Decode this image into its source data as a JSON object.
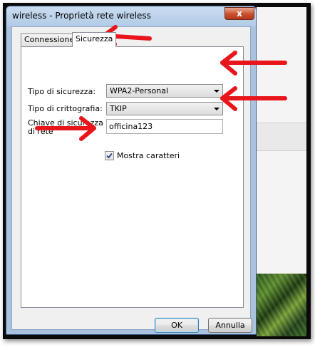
{
  "window": {
    "title": "wireless - Proprietà rete wireless",
    "close_glyph": "x"
  },
  "tabs": [
    {
      "label": "Connessione",
      "active": false
    },
    {
      "label": "Sicurezza",
      "active": true
    }
  ],
  "form": {
    "security_type_label": "Tipo di sicurezza:",
    "security_type_value": "WPA2-Personal",
    "encryption_type_label": "Tipo di crittografia:",
    "encryption_type_value": "TKIP",
    "network_key_label_line1": "Chiave di sicurezza",
    "network_key_label_line2": "di rete",
    "network_key_value": "officina123",
    "show_chars_label": "Mostra caratteri",
    "show_chars_checked": true
  },
  "buttons": {
    "ok_label": "OK",
    "cancel_label": "Annulla"
  },
  "colors": {
    "annotation_arrow": "#e8151a",
    "title_bar": "#b2cbe6",
    "close_button": "#c94f2e"
  }
}
